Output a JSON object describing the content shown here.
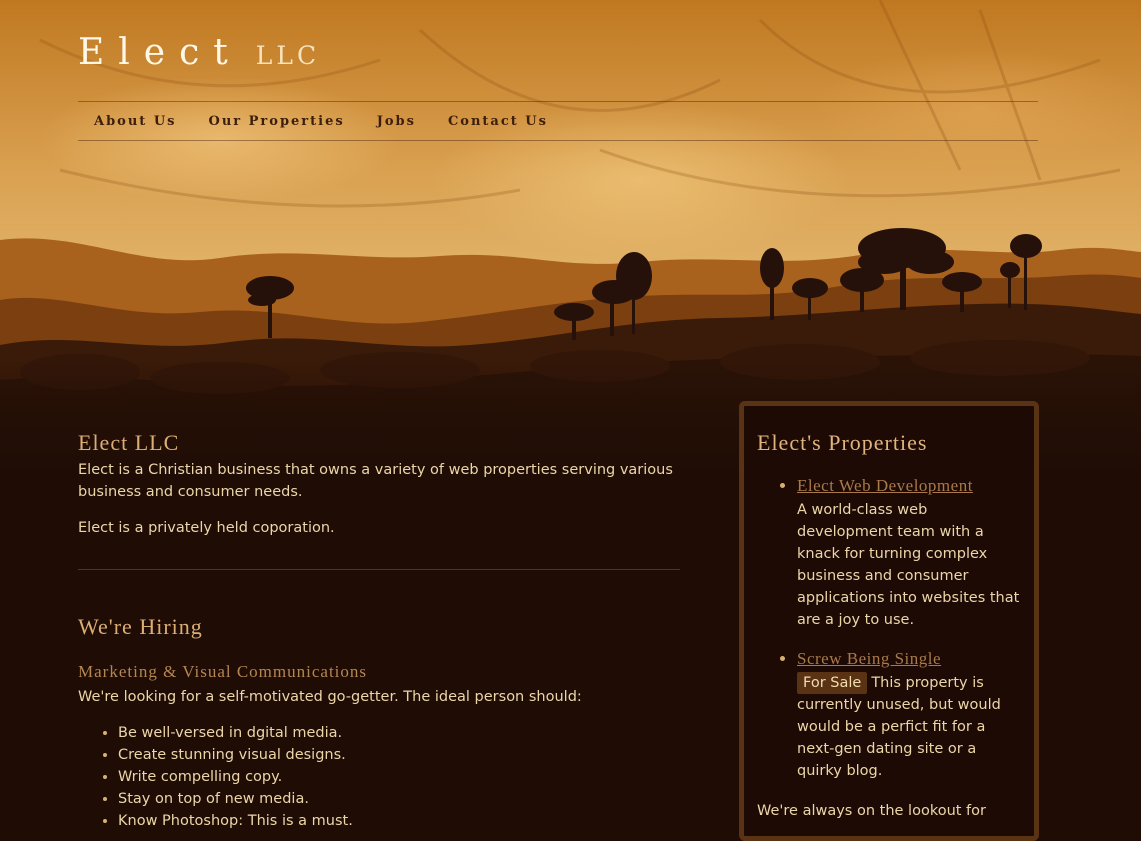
{
  "brand": {
    "name": "Elect",
    "suffix": "LLC"
  },
  "nav": {
    "items": [
      {
        "label": "About Us"
      },
      {
        "label": "Our Properties"
      },
      {
        "label": "Jobs"
      },
      {
        "label": "Contact Us"
      }
    ]
  },
  "intro": {
    "title": "Elect LLC",
    "paragraphs": [
      "Elect is a Christian business that owns a variety of web properties serving various business and consumer needs.",
      "Elect is a privately held coporation."
    ]
  },
  "hiring": {
    "title": "We're Hiring",
    "job_title": "Marketing & Visual Communications",
    "description": "We're looking for a self-motivated go-getter. The ideal person should:",
    "requirements": [
      "Be well-versed in dgital media.",
      "Create stunning visual designs.",
      "Write compelling copy.",
      "Stay on top of new media.",
      "Know Photoshop: This is a must."
    ]
  },
  "sidebar": {
    "title": "Elect's Properties",
    "properties": [
      {
        "name": "Elect Web Development",
        "badge": "",
        "description": "A world-class web development team with a knack for turning complex business and consumer applications into websites that are a joy to use."
      },
      {
        "name": "Screw Being Single",
        "badge": "For Sale",
        "description": "This property is currently unused, but would would be a perfict fit for a next-gen dating site or a quirky blog."
      }
    ],
    "footer_text": "We're always on the lookout for"
  },
  "colors": {
    "page_background": "#1e0c05",
    "accent_title": "#dcae76",
    "link": "#a8794a",
    "sidebar_border": "#5a3214",
    "nav_text": "#3c1e0a"
  }
}
